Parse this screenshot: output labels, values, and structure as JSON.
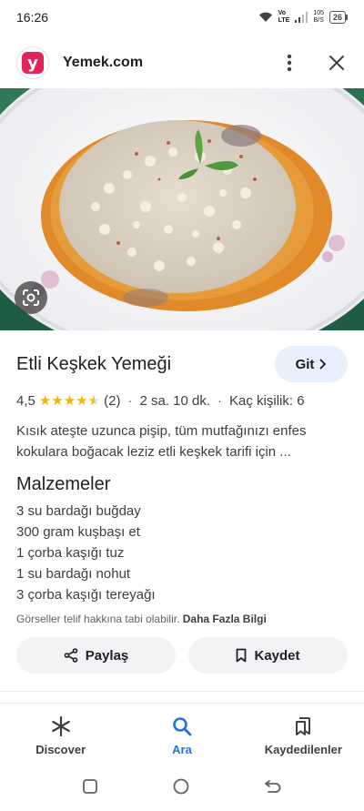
{
  "status_bar": {
    "time": "16:26",
    "network_top": "Vo",
    "network_bottom": "LTE",
    "speed_value": "105",
    "speed_unit": "B/S",
    "battery": "26"
  },
  "header": {
    "logo_letter": "y",
    "site_name": "Yemek.com",
    "brand_color": "#e3245b"
  },
  "recipe": {
    "title": "Etli Keşkek Yemeği",
    "go_label": "Git",
    "rating": "4,5",
    "rating_count": "(2)",
    "duration": "2 sa. 10 dk.",
    "servings": "Kaç kişilik: 6",
    "description": "Kısık ateşte uzunca pişip, tüm mutfağınızı enfes kokulara boğacak leziz etli keşkek tarifi için ..."
  },
  "ingredients": {
    "heading": "Malzemeler",
    "items": [
      "3 su bardağı buğday",
      "300 gram kuşbaşı et",
      "1 çorba kaşığı tuz",
      "1 su bardağı nohut",
      "3 çorba kaşığı tereyağı"
    ]
  },
  "copyright": {
    "text": "Görseller telif hakkına tabi olabilir.",
    "link": "Daha Fazla Bilgi"
  },
  "actions": {
    "share_label": "Paylaş",
    "save_label": "Kaydet"
  },
  "bottom_nav": {
    "items": [
      {
        "label": "Discover",
        "icon": "asterisk-icon"
      },
      {
        "label": "Ara",
        "icon": "search-icon"
      },
      {
        "label": "Kaydedilenler",
        "icon": "bookmarks-icon"
      }
    ],
    "active_color": "#1a73e8"
  }
}
